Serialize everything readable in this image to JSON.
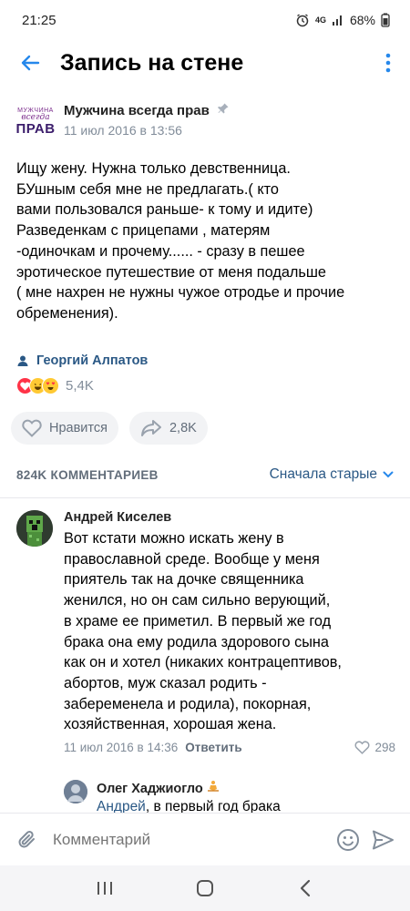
{
  "status": {
    "time": "21:25",
    "network": "4G",
    "battery": "68%"
  },
  "header": {
    "title": "Запись на стене"
  },
  "post": {
    "logo": {
      "line1": "МУЖЧИНА",
      "line2": "всегда",
      "line3": "ПРАВ"
    },
    "author": "Мужчина всегда прав",
    "date": "11 июл 2016 в 13:56",
    "text": "Ищу жену. Нужна только девственница.\nБУшным себя мне не предлагать.( кто\nвами пользовался раньше- к тому и идите)\nРазведенкам с прицепами , матерям\n-одиночкам и прочему...... - сразу в пешее\nэротическое путешествие от меня подальше\n( мне нахрен не нужны чужое отродье и прочие\nобременения).",
    "signer": "Георгий Алпатов",
    "reactions_count": "5,4K",
    "like_label": "Нравится",
    "share_count": "2,8K"
  },
  "comments": {
    "count_label": "824K КОММЕНТАРИЕВ",
    "sort_label": "Сначала старые",
    "first": {
      "author": "Андрей Киселев",
      "text": "Вот кстати можно искать жену в\nправославной среде. Вообще у меня\nприятель так на дочке священника\nженился, но он сам сильно верующий,\nв храме  ее приметил. В первый же год\nбрака она ему родила здорового сына\nкак он и хотел (никаких контрацептивов,\nабортов, муж сказал родить -\nзабеременела и родила), покорная,\nхозяйственная, хорошая жена.",
      "date": "11 июл 2016 в 14:36",
      "reply_label": "Ответить",
      "likes": "298"
    },
    "reply": {
      "author": "Олег Хаджиогло",
      "mention": "Андрей",
      "text": ", в первый год брака"
    }
  },
  "composer": {
    "placeholder": "Комментарий"
  },
  "colors": {
    "accent": "#2a5885",
    "link": "#2688eb",
    "muted": "#818c99"
  }
}
